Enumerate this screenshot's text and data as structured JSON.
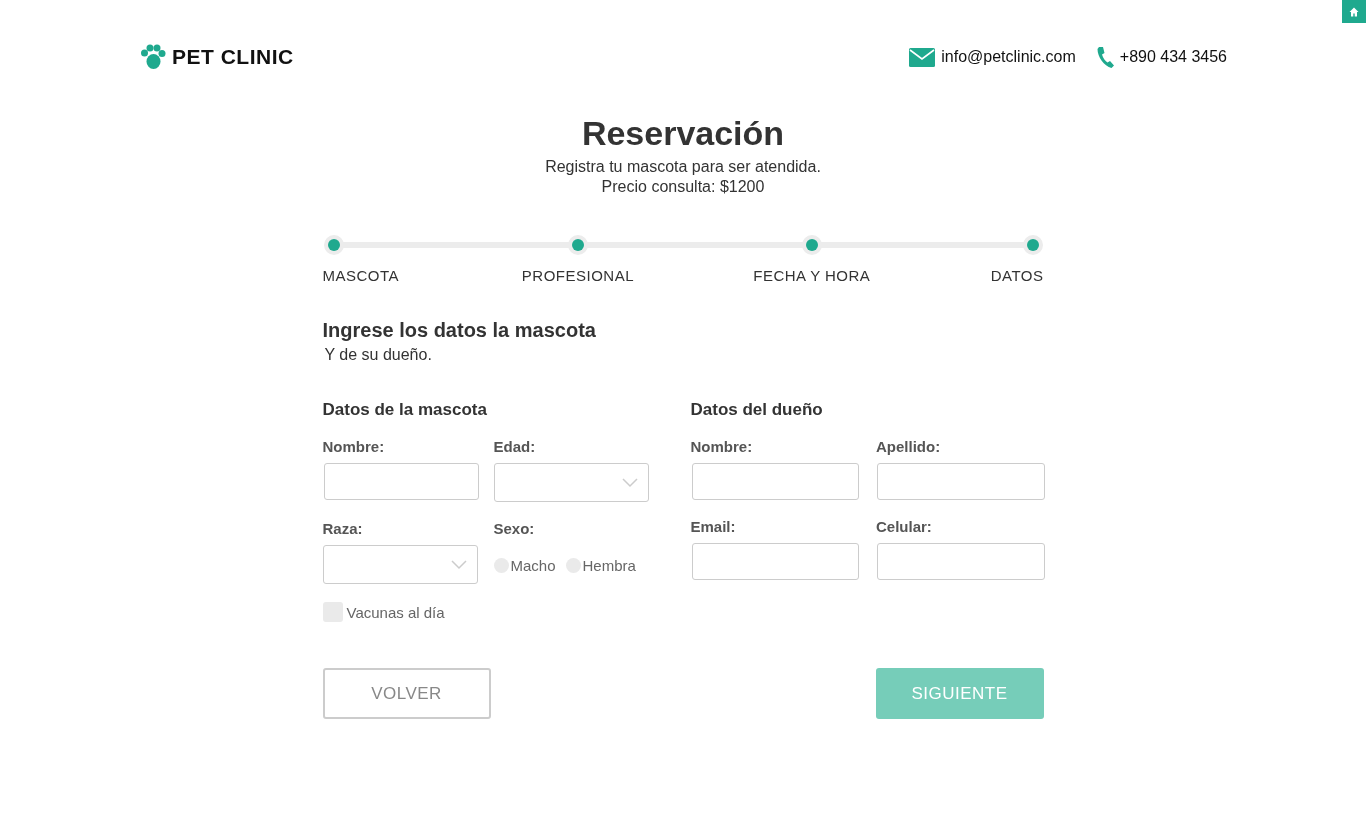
{
  "header": {
    "brand": "PET CLINIC",
    "email": "info@petclinic.com",
    "phone": "+890 434 3456"
  },
  "hero": {
    "title": "Reservación",
    "subtitle": "Registra tu mascota para ser atendida.",
    "price": "Precio consulta: $1200"
  },
  "steps": [
    {
      "label": "MASCOTA",
      "done": true
    },
    {
      "label": "PROFESIONAL",
      "done": true
    },
    {
      "label": "FECHA Y HORA",
      "done": true
    },
    {
      "label": "DATOS",
      "done": true
    }
  ],
  "intro": {
    "title": "Ingrese los datos la mascota",
    "subtitle": "Y de su dueño."
  },
  "pet_section": {
    "title": "Datos de la mascota",
    "fields": [
      {
        "kind": "text",
        "label": "Nombre:"
      },
      {
        "kind": "select",
        "label": "Edad:"
      },
      {
        "kind": "select",
        "label": "Raza:"
      },
      {
        "kind": "radio",
        "label": "Sexo:",
        "options": [
          {
            "label": "Macho",
            "selected": false
          },
          {
            "label": "Hembra",
            "selected": false
          }
        ]
      }
    ],
    "checkbox": {
      "label": "Vacunas al día",
      "checked": false
    }
  },
  "owner_section": {
    "title": "Datos del dueño",
    "fields": [
      {
        "kind": "text",
        "label": "Nombre:"
      },
      {
        "kind": "text",
        "label": "Apellido:"
      },
      {
        "kind": "text",
        "label": "Email:"
      },
      {
        "kind": "text",
        "label": "Celular:"
      }
    ]
  },
  "buttons": [
    {
      "kind": "back",
      "label": "VOLVER",
      "disabled": false
    },
    {
      "kind": "next",
      "label": "SIGUIENTE",
      "disabled": true
    }
  ]
}
